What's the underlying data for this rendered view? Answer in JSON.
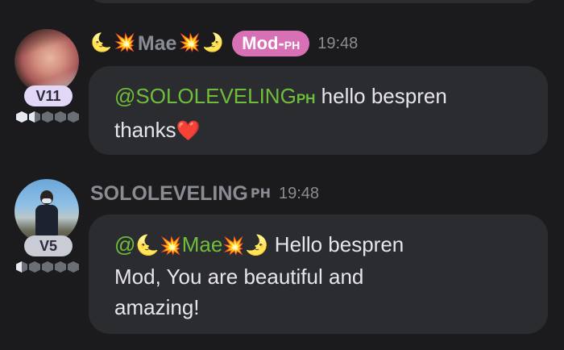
{
  "messages": [
    {
      "username": "Mae",
      "name_emoji_left": "🌜",
      "name_emoji_mid": "💥",
      "name_emoji_right": "🌛",
      "role_badge_main": "Mod-",
      "role_badge_small": "PH",
      "timestamp": "19:48",
      "level": "V11",
      "mention_main": "@SOLOLEVELING",
      "mention_small": "PH",
      "text_line1": " hello bespren",
      "text_line2": "thanks",
      "heart": "❤️"
    },
    {
      "username_main": "SOLOLEVELING",
      "username_small": "PH",
      "timestamp": "19:48",
      "level": "V5",
      "mention_at": "@",
      "mention_emoji_left": "🌜",
      "mention_emoji_mid": "💥",
      "mention_name": "Mae",
      "mention_emoji_mid2": "💥",
      "mention_emoji_right": "🌛",
      "text_line1": " Hello bespren",
      "text_line2": "Mod, You are beautiful and",
      "text_line3": "amazing!"
    }
  ],
  "colors": {
    "background": "#1b1b1e",
    "bubble": "#2b2c30",
    "mention": "#6fbe3b",
    "role_badge": "#d870b5",
    "muted": "#8a8c93"
  },
  "icons": {
    "avatar_mae": "user-avatar-photo",
    "avatar_solo": "user-avatar-photo",
    "level_dots": "hexagon-level-icon"
  }
}
